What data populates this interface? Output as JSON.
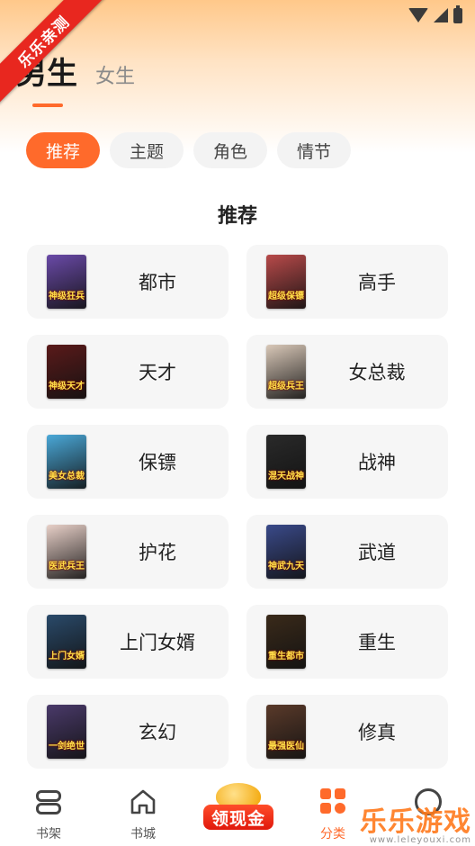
{
  "ribbon": "乐乐亲测",
  "gender": {
    "male": "男生",
    "female": "女生"
  },
  "tabs": [
    {
      "label": "推荐",
      "active": true
    },
    {
      "label": "主题",
      "active": false
    },
    {
      "label": "角色",
      "active": false
    },
    {
      "label": "情节",
      "active": false
    }
  ],
  "section_title": "推荐",
  "categories": [
    {
      "label": "都市",
      "cover_text": "神级狂兵",
      "cover_color": "#6a4aa8"
    },
    {
      "label": "高手",
      "cover_text": "超级保镖",
      "cover_color": "#b84a4a"
    },
    {
      "label": "天才",
      "cover_text": "神级天才",
      "cover_color": "#5a1a1a"
    },
    {
      "label": "女总裁",
      "cover_text": "超级兵王",
      "cover_color": "#d9c8b8"
    },
    {
      "label": "保镖",
      "cover_text": "美女总裁",
      "cover_color": "#4aa8d8"
    },
    {
      "label": "战神",
      "cover_text": "混天战神",
      "cover_color": "#2a2a2a"
    },
    {
      "label": "护花",
      "cover_text": "医武兵王",
      "cover_color": "#e8d0c8"
    },
    {
      "label": "武道",
      "cover_text": "神武九天",
      "cover_color": "#3a4a8a"
    },
    {
      "label": "上门女婿",
      "cover_text": "上门女婿",
      "cover_color": "#2a4a6a"
    },
    {
      "label": "重生",
      "cover_text": "重生都市",
      "cover_color": "#3a2a1a"
    },
    {
      "label": "玄幻",
      "cover_text": "一剑绝世",
      "cover_color": "#4a3a6a"
    },
    {
      "label": "修真",
      "cover_text": "最强医仙",
      "cover_color": "#5a3a2a"
    }
  ],
  "nav": {
    "bookshelf": "书架",
    "bookstore": "书城",
    "cash": "领现金",
    "category": "分类",
    "accent": "#ff6a2b"
  },
  "watermark": {
    "main": "乐乐游戏",
    "sub": "www.leleyouxi.com"
  }
}
